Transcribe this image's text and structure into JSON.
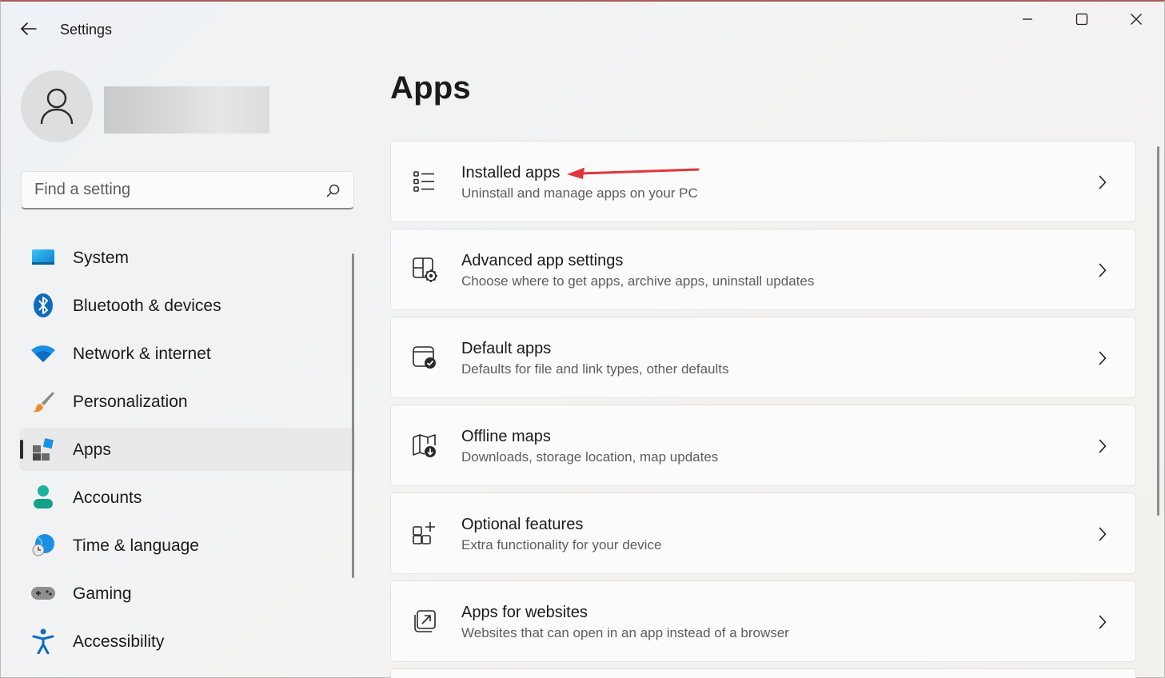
{
  "window": {
    "title": "Settings"
  },
  "search": {
    "placeholder": "Find a setting"
  },
  "sidebar": {
    "items": [
      {
        "label": "System",
        "icon": "system-icon"
      },
      {
        "label": "Bluetooth & devices",
        "icon": "bluetooth-icon"
      },
      {
        "label": "Network & internet",
        "icon": "wifi-icon"
      },
      {
        "label": "Personalization",
        "icon": "paintbrush-icon"
      },
      {
        "label": "Apps",
        "icon": "apps-icon",
        "active": true
      },
      {
        "label": "Accounts",
        "icon": "accounts-icon"
      },
      {
        "label": "Time & language",
        "icon": "globe-clock-icon"
      },
      {
        "label": "Gaming",
        "icon": "gamepad-icon"
      },
      {
        "label": "Accessibility",
        "icon": "accessibility-icon"
      }
    ]
  },
  "main": {
    "title": "Apps",
    "cards": [
      {
        "title": "Installed apps",
        "subtitle": "Uninstall and manage apps on your PC",
        "icon": "list-icon"
      },
      {
        "title": "Advanced app settings",
        "subtitle": "Choose where to get apps, archive apps, uninstall updates",
        "icon": "app-settings-icon"
      },
      {
        "title": "Default apps",
        "subtitle": "Defaults for file and link types, other defaults",
        "icon": "default-apps-icon"
      },
      {
        "title": "Offline maps",
        "subtitle": "Downloads, storage location, map updates",
        "icon": "map-download-icon"
      },
      {
        "title": "Optional features",
        "subtitle": "Extra functionality for your device",
        "icon": "add-grid-icon"
      },
      {
        "title": "Apps for websites",
        "subtitle": "Websites that can open in an app instead of a browser",
        "icon": "open-external-icon"
      }
    ]
  },
  "colors": {
    "annotation_arrow": "#e0353d",
    "accent_blue": "#0f6cbd"
  }
}
